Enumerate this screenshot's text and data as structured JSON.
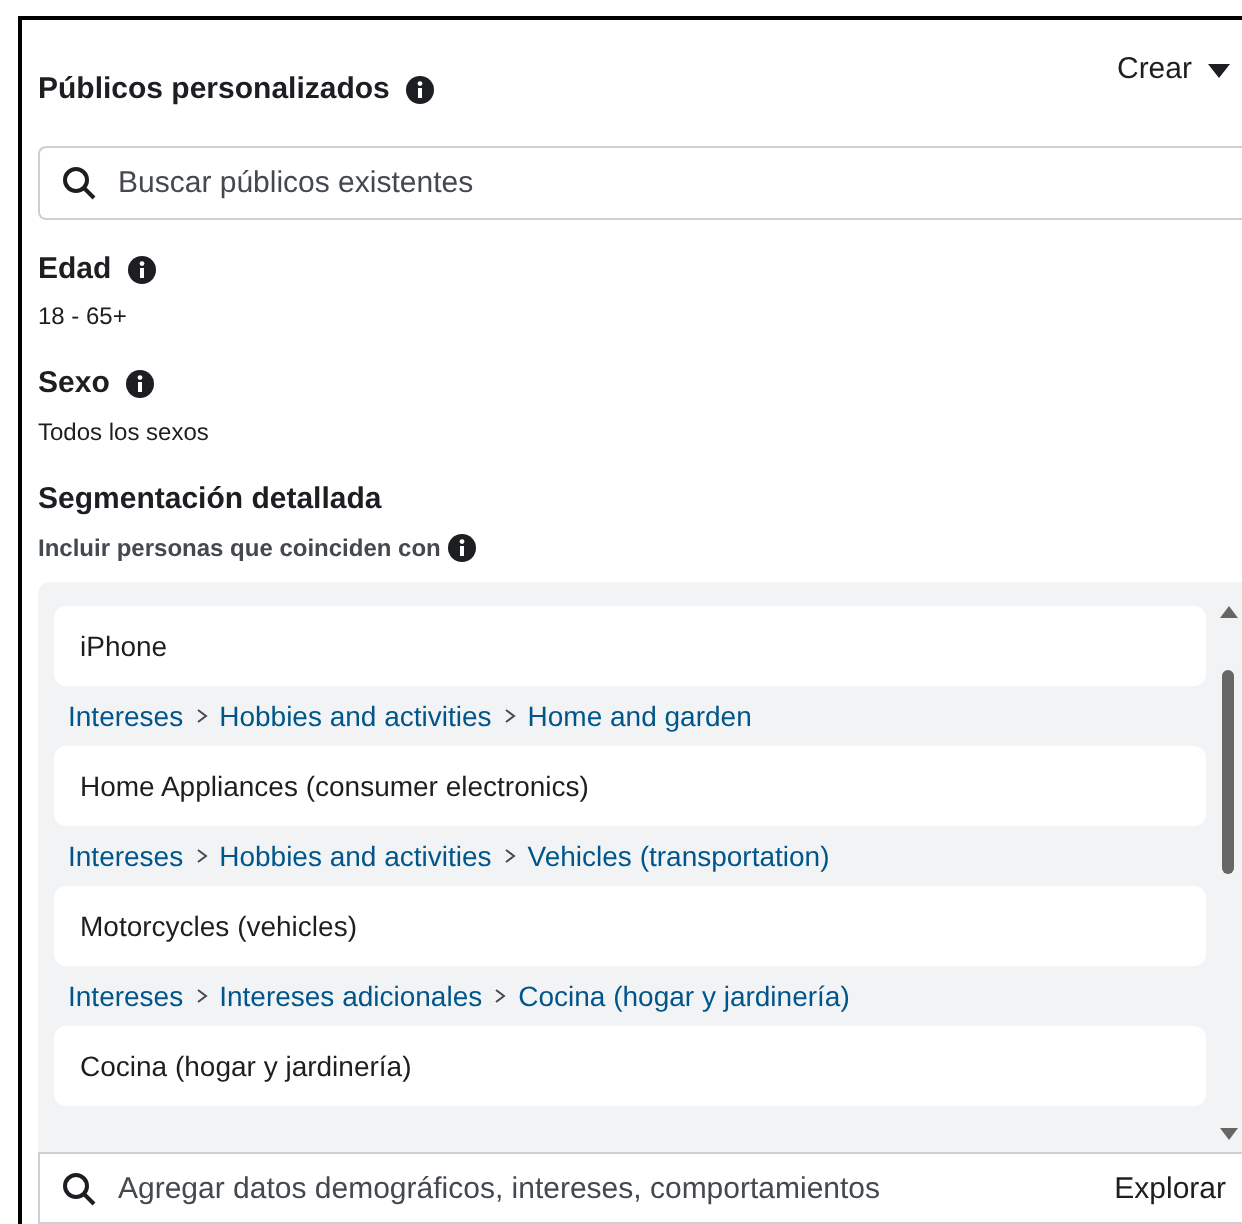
{
  "header": {
    "title": "Públicos personalizados",
    "create_button": "Crear"
  },
  "audience_search": {
    "placeholder": "Buscar públicos existentes"
  },
  "fields": [
    {
      "label": "Edad",
      "value": "18 - 65+"
    },
    {
      "label": "Sexo",
      "value": "Todos los sexos"
    }
  ],
  "detailed_targeting": {
    "title": "Segmentación detallada",
    "subtitle": "Incluir personas que coinciden con",
    "rows": [
      {
        "kind": "item",
        "text": "iPhone"
      },
      {
        "kind": "path",
        "segments": [
          "Intereses",
          "Hobbies and activities",
          "Home and garden"
        ]
      },
      {
        "kind": "item",
        "text": "Home Appliances (consumer electronics)"
      },
      {
        "kind": "path",
        "segments": [
          "Intereses",
          "Hobbies and activities",
          "Vehicles (transportation)"
        ]
      },
      {
        "kind": "item",
        "text": "Motorcycles (vehicles)"
      },
      {
        "kind": "path",
        "segments": [
          "Intereses",
          "Intereses adicionales",
          "Cocina (hogar y jardinería)"
        ]
      },
      {
        "kind": "item",
        "text": "Cocina (hogar y jardinería)"
      }
    ],
    "search": {
      "placeholder": "Agregar datos demográficos, intereses, comportamientos",
      "browse_button": "Explorar"
    }
  }
}
